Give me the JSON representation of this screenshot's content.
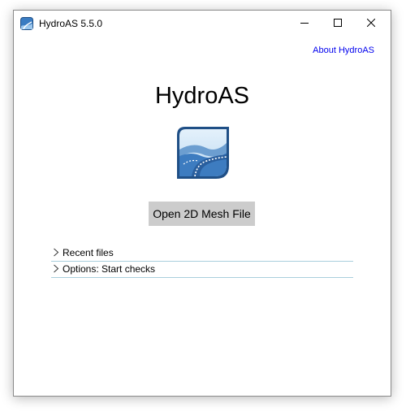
{
  "window": {
    "title": "HydroAS 5.5.0",
    "controls": [
      "minimize-icon",
      "maximize-icon",
      "close-icon"
    ]
  },
  "header": {
    "about_link": "About HydroAS"
  },
  "main": {
    "app_name": "HydroAS",
    "logo_icon": "hydroas-river-logo-icon",
    "open_button_label": "Open 2D Mesh File",
    "expanders": [
      {
        "label": "Recent files",
        "icon": "chevron-right-icon",
        "expanded": false
      },
      {
        "label": "Options: Start checks",
        "icon": "chevron-right-icon",
        "expanded": false
      }
    ]
  },
  "colors": {
    "link": "#0000ee",
    "button_bg": "#cccccc",
    "divider": "#a9cfdc",
    "logo_blue": "#2f6fb5"
  }
}
